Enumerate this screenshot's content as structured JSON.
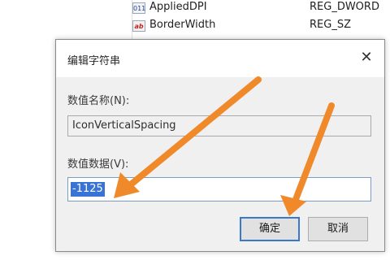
{
  "registry": {
    "rows": [
      {
        "icon": "binary-value-icon",
        "name": "AppliedDPI",
        "type": "REG_DWORD"
      },
      {
        "icon": "string-value-icon",
        "name": "BorderWidth",
        "type": "REG_SZ"
      }
    ]
  },
  "dialog": {
    "title": "编辑字符串",
    "name_label": "数值名称(N):",
    "name_value": "IconVerticalSpacing",
    "data_label": "数值数据(V):",
    "data_value": "-1125",
    "ok_label": "确定",
    "cancel_label": "取消",
    "close_glyph": "✕"
  },
  "colors": {
    "arrow": "#f0892a",
    "selection": "#3874d6",
    "dialog_bg": "#f0f0f0"
  }
}
